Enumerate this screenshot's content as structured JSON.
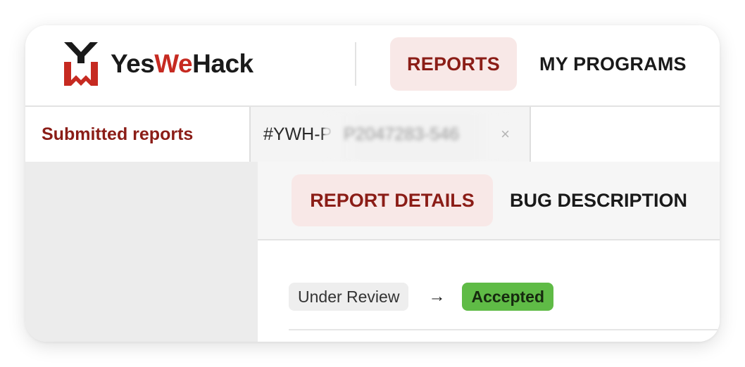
{
  "brand": {
    "name_part1": "Yes",
    "name_part2": "We",
    "name_part3": "Hack",
    "logo_icon": "yeswehack-logo-mark",
    "colors": {
      "accent": "#c62a21",
      "dark": "#1a1a1a",
      "highlight_bg": "#f8e8e7",
      "accent_text": "#8b1d17",
      "success": "#5fbb46"
    }
  },
  "nav": {
    "reports_label": "REPORTS",
    "programs_label": "MY PROGRAMS"
  },
  "tabs": {
    "submitted_label": "Submitted reports",
    "report_id_prefix": "#YWH-P",
    "report_id_redacted": "P2047283-546",
    "close_icon": "close-icon",
    "close_glyph": "×"
  },
  "subtabs": {
    "details_label": "REPORT DETAILS",
    "bug_label": "BUG DESCRIPTION"
  },
  "status": {
    "from": "Under Review",
    "arrow": "→",
    "to": "Accepted"
  }
}
